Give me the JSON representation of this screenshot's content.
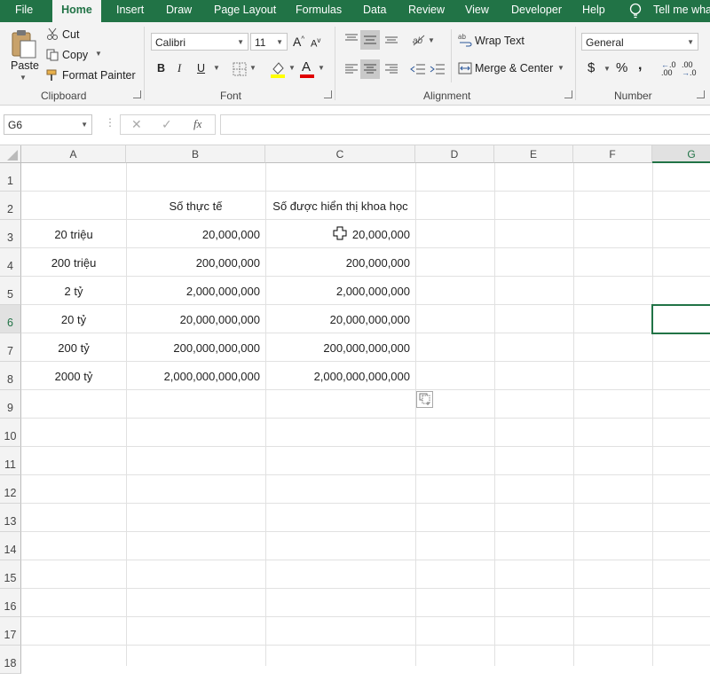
{
  "ribbon_tabs": [
    "File",
    "Home",
    "Insert",
    "Draw",
    "Page Layout",
    "Formulas",
    "Data",
    "Review",
    "View",
    "Developer",
    "Help"
  ],
  "tell_me": "Tell me wha",
  "clipboard": {
    "paste": "Paste",
    "cut": "Cut",
    "copy": "Copy",
    "format_painter": "Format Painter",
    "label": "Clipboard"
  },
  "font": {
    "name": "Calibri",
    "size": "11",
    "label": "Font",
    "bold": "B",
    "italic": "I",
    "underline": "U",
    "font_color_letter": "A",
    "highlight_color": "#ffff00",
    "font_color": "#e00000"
  },
  "alignment": {
    "wrap_text": "Wrap Text",
    "merge_center": "Merge & Center",
    "label": "Alignment"
  },
  "number": {
    "format": "General",
    "label": "Number",
    "currency": "$",
    "percent": "%",
    "comma": ",",
    "inc_decimal": ".00",
    "dec_decimal": ".0"
  },
  "formula_bar": {
    "name_box": "G6",
    "fx": "fx",
    "formula": ""
  },
  "columns": [
    "A",
    "B",
    "C",
    "D",
    "E",
    "F",
    "G"
  ],
  "selected_column": "G",
  "selected_row": "6",
  "rows": [
    "1",
    "2",
    "3",
    "4",
    "5",
    "6",
    "7",
    "8",
    "9",
    "10",
    "11",
    "12",
    "13",
    "14",
    "15",
    "16",
    "17",
    "18"
  ],
  "cells": {
    "B2": "Số thực tế",
    "C2": "Số được hiển thị khoa học",
    "A3": "20 triệu",
    "B3": "20,000,000",
    "C3": "20,000,000",
    "A4": "200 triệu",
    "B4": "200,000,000",
    "C4": "200,000,000",
    "A5": "2 tỷ",
    "B5": "2,000,000,000",
    "C5": "2,000,000,000",
    "A6": "20 tỷ",
    "B6": "20,000,000,000",
    "C6": "20,000,000,000",
    "A7": "200 tỷ",
    "B7": "200,000,000,000",
    "C7": "200,000,000,000",
    "A8": "2000 tỷ",
    "B8": "2,000,000,000,000",
    "C8": "2,000,000,000,000"
  },
  "colors": {
    "accent": "#217346",
    "selection_border": "#217346"
  }
}
